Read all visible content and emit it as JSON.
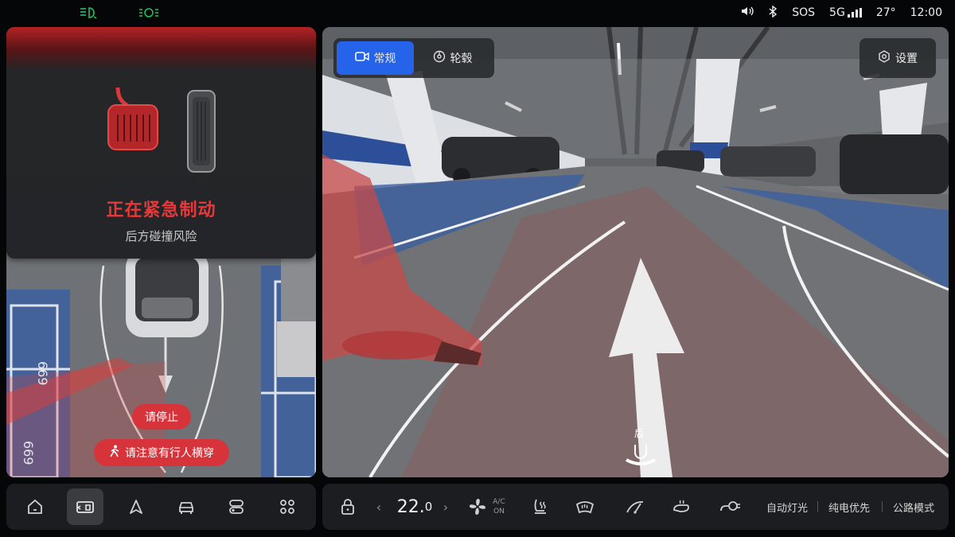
{
  "status_bar": {
    "left_icons": [
      "low-beam-icon",
      "position-light-icon"
    ],
    "volume_icon": "volume-icon",
    "bluetooth_icon": "bluetooth-icon",
    "sos": "SOS",
    "network": "5G",
    "temperature": "27°",
    "time": "12:00"
  },
  "alert": {
    "title": "正在紧急制动",
    "subtitle": "后方碰撞风险",
    "brake_pedal_icon": "brake-pedal-icon",
    "accelerator_pedal_icon": "accelerator-pedal-icon",
    "stop_pill": "请停止",
    "pedestrian_pill": "请注意有行人横穿"
  },
  "camera": {
    "tabs": [
      {
        "label": "常规",
        "icon": "camera-icon",
        "active": true
      },
      {
        "label": "轮毂",
        "icon": "wheel-icon",
        "active": false
      }
    ],
    "settings_label": "设置",
    "rear_label": "后",
    "bay_numbers": [
      "669",
      "669"
    ]
  },
  "dock_left": {
    "items": [
      {
        "icon": "home-icon",
        "active": false
      },
      {
        "icon": "camera-view-icon",
        "active": true
      },
      {
        "icon": "navigation-icon",
        "active": false
      },
      {
        "icon": "car-icon",
        "active": false
      },
      {
        "icon": "toggle-icon",
        "active": false
      },
      {
        "icon": "apps-grid-icon",
        "active": false
      }
    ]
  },
  "climate": {
    "lock_icon": "lock-icon",
    "temp_value": "22.",
    "temp_decimal": "0",
    "ac_line1": "A/C",
    "ac_line2": "ON",
    "fan_icon": "fan-icon",
    "seat_heat_icon": "seat-heat-icon",
    "front_defrost_icon": "front-defrost-icon",
    "wiper_icon": "wiper-icon",
    "mirror_heat_icon": "mirror-heat-icon",
    "charge_port_icon": "charge-port-icon",
    "modes": [
      "自动灯光",
      "纯电优先",
      "公路模式"
    ]
  },
  "colors": {
    "alert_red": "#e8393a",
    "pill_red": "#d6343a",
    "active_blue": "#2563eb"
  }
}
